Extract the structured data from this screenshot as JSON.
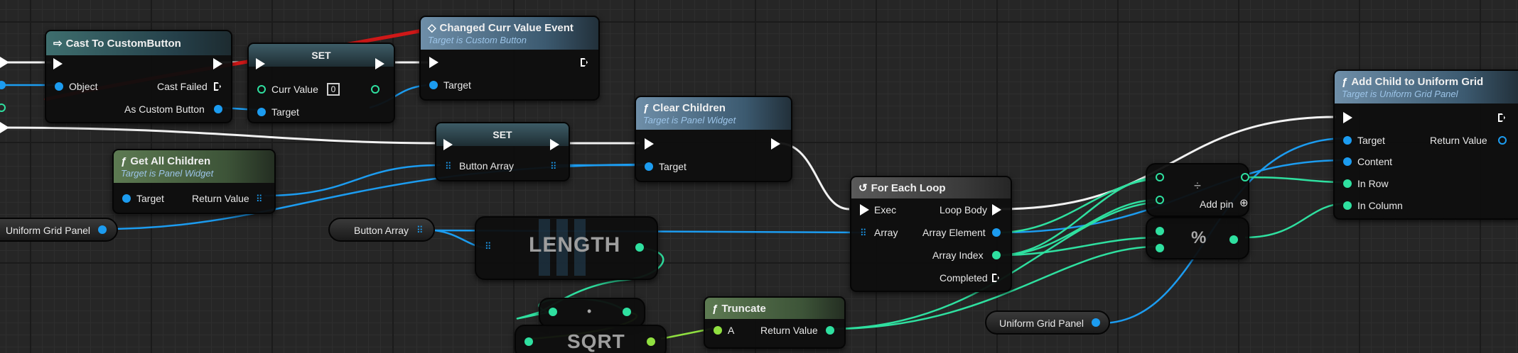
{
  "nodes": {
    "cast": {
      "title": "Cast To CustomButton",
      "icon": "cast-icon",
      "object_label": "Object",
      "cast_failed_label": "Cast Failed",
      "as_label": "As Custom Button"
    },
    "set1": {
      "title": "SET",
      "curr_value_label": "Curr Value",
      "curr_value": "0",
      "target_label": "Target"
    },
    "changed": {
      "title": "Changed Curr Value Event",
      "subtitle": "Target is Custom Button",
      "target_label": "Target",
      "icon": "event-icon"
    },
    "set2": {
      "title": "SET",
      "button_array_label": "Button Array"
    },
    "clear": {
      "title": "Clear Children",
      "subtitle": "Target is Panel Widget",
      "target_label": "Target",
      "icon": "function-icon"
    },
    "get_children": {
      "title": "Get All Children",
      "subtitle": "Target is Panel Widget",
      "target_label": "Target",
      "return_label": "Return Value",
      "icon": "function-icon"
    },
    "uniform_left": {
      "label": "Uniform Grid Panel"
    },
    "button_array_var": {
      "label": "Button Array"
    },
    "length": {
      "label": "LENGTH"
    },
    "multiply": {
      "label": "•"
    },
    "sqrt": {
      "label": "SQRT"
    },
    "truncate": {
      "title": "Truncate",
      "a_label": "A",
      "return_label": "Return Value",
      "icon": "function-icon"
    },
    "foreach": {
      "title": "For Each Loop",
      "exec_label": "Exec",
      "array_label": "Array",
      "loop_body_label": "Loop Body",
      "element_label": "Array Element",
      "index_label": "Array Index",
      "completed_label": "Completed",
      "icon": "loop-icon"
    },
    "divide": {
      "label": "÷",
      "add_pin_label": "Add pin"
    },
    "modulo": {
      "label": "%"
    },
    "uniform_right": {
      "label": "Uniform Grid Panel"
    },
    "add_child": {
      "title": "Add Child to Uniform Grid",
      "subtitle": "Target is Uniform Grid Panel",
      "target_label": "Target",
      "content_label": "Content",
      "row_label": "In Row",
      "column_label": "In Column",
      "return_label": "Return Value",
      "icon": "function-icon"
    }
  },
  "colors": {
    "exec_wire": "#ffffff",
    "object_wire": "#1c9cf0",
    "int_wire": "#2fe0a0",
    "float_wire": "#90e040",
    "annotation": "#d01818"
  }
}
